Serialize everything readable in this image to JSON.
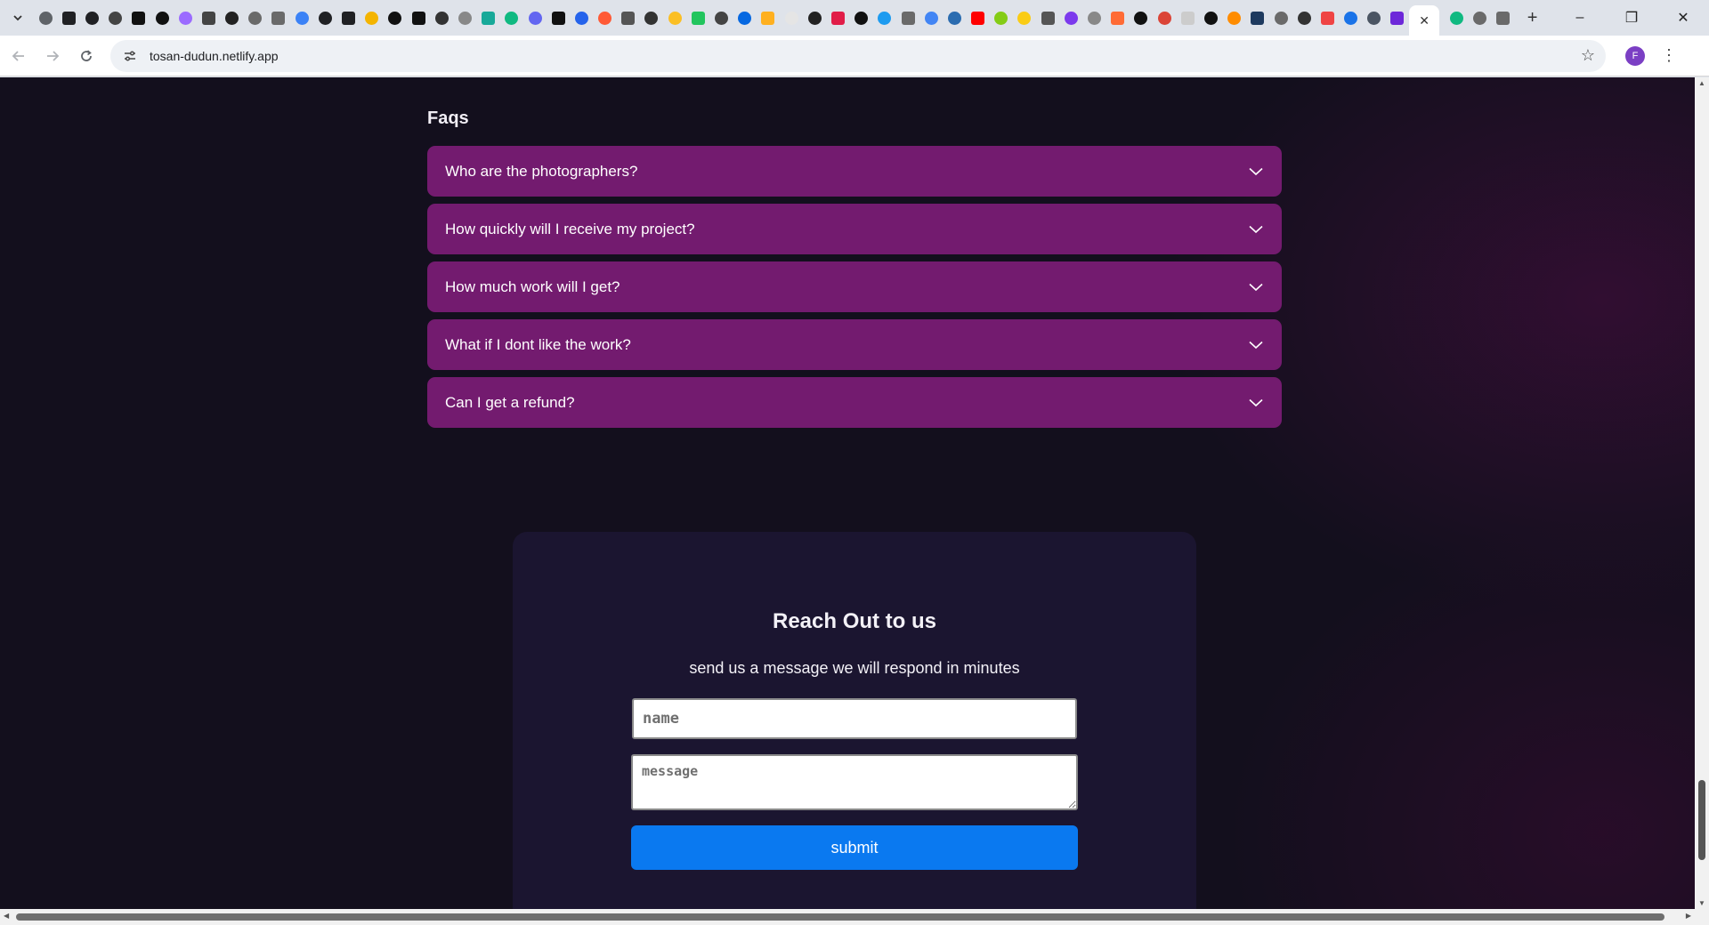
{
  "browser": {
    "url": "tosan-dudun.netlify.app",
    "profile_initial": "F",
    "tab_favicon_colors": [
      "#5f6368",
      "#202124",
      "#202124",
      "#444444",
      "#111111",
      "#111111",
      "#9b6bff",
      "#444444",
      "#222222",
      "#6a6a6a",
      "#6a6a6a",
      "#3b82f6",
      "#202124",
      "#202124",
      "#f4b400",
      "#111111",
      "#111111",
      "#333333",
      "#888888",
      "#18a999",
      "#10b981",
      "#6366f1",
      "#111111",
      "#2563eb",
      "#ff5a36",
      "#555555",
      "#333333",
      "#fbbf24",
      "#22c55e",
      "#444444",
      "#0668e1",
      "#ffb020",
      "#e5e5e5",
      "#222222",
      "#e11d48",
      "#111111",
      "#1d9bf0",
      "#6a6a6a",
      "#4285f4",
      "#2b6cb0",
      "#ff0000",
      "#84cc16",
      "#facc15",
      "#555555",
      "#7c3aed",
      "#888888",
      "#ff6b35",
      "#111111",
      "#db4437",
      "#cccccc",
      "#111111",
      "#ff8c00",
      "#1e3a5f",
      "#6a6a6a",
      "#333333",
      "#ef4444",
      "#1a73e8",
      "#4b5563",
      "#6d28d9",
      "#10b981",
      "#6a6a6a",
      "#6a6a6a"
    ],
    "window_controls": {
      "minimize": "–",
      "maximize": "❐",
      "close": "✕"
    }
  },
  "faqs": {
    "title": "Faqs",
    "items": [
      {
        "question": "Who are the photographers?"
      },
      {
        "question": "How quickly will I receive my project?"
      },
      {
        "question": "How much work will I get?"
      },
      {
        "question": "What if I dont like the work?"
      },
      {
        "question": "Can I get a refund?"
      }
    ]
  },
  "contact": {
    "title": "Reach Out to us",
    "subtitle": "send us a message we will respond in minutes",
    "name_placeholder": "name",
    "message_placeholder": "message",
    "submit_label": "submit"
  },
  "colors": {
    "page_bg": "#130f1d",
    "faq_bg": "#731b6f",
    "card_bg": "#1b1530",
    "submit_bg": "#0a79f0"
  }
}
